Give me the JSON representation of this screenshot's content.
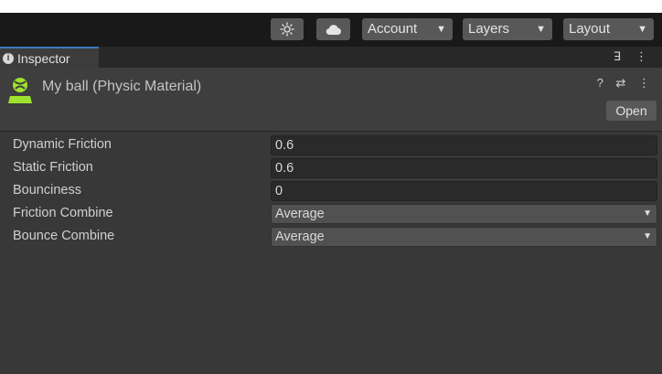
{
  "toolbar": {
    "account_label": "Account",
    "layers_label": "Layers",
    "layout_label": "Layout",
    "caret": "▼"
  },
  "tab": {
    "label": "Inspector",
    "info_glyph": "i",
    "lock_glyph": "ꓱ",
    "menu_glyph": "⋮"
  },
  "header": {
    "title": "My ball (Physic Material)",
    "help_glyph": "?",
    "presets_glyph": "⇄",
    "menu_glyph": "⋮",
    "open_label": "Open"
  },
  "properties": [
    {
      "label": "Dynamic Friction",
      "value": "0.6",
      "kind": "float"
    },
    {
      "label": "Static Friction",
      "value": "0.6",
      "kind": "float"
    },
    {
      "label": "Bounciness",
      "value": "0",
      "kind": "float"
    },
    {
      "label": "Friction Combine",
      "value": "Average",
      "kind": "dropdown"
    },
    {
      "label": "Bounce Combine",
      "value": "Average",
      "kind": "dropdown"
    }
  ],
  "colors": {
    "accent_tab": "#3a79bb",
    "material_icon": "#9ee22e",
    "panel_bg": "#383838"
  }
}
